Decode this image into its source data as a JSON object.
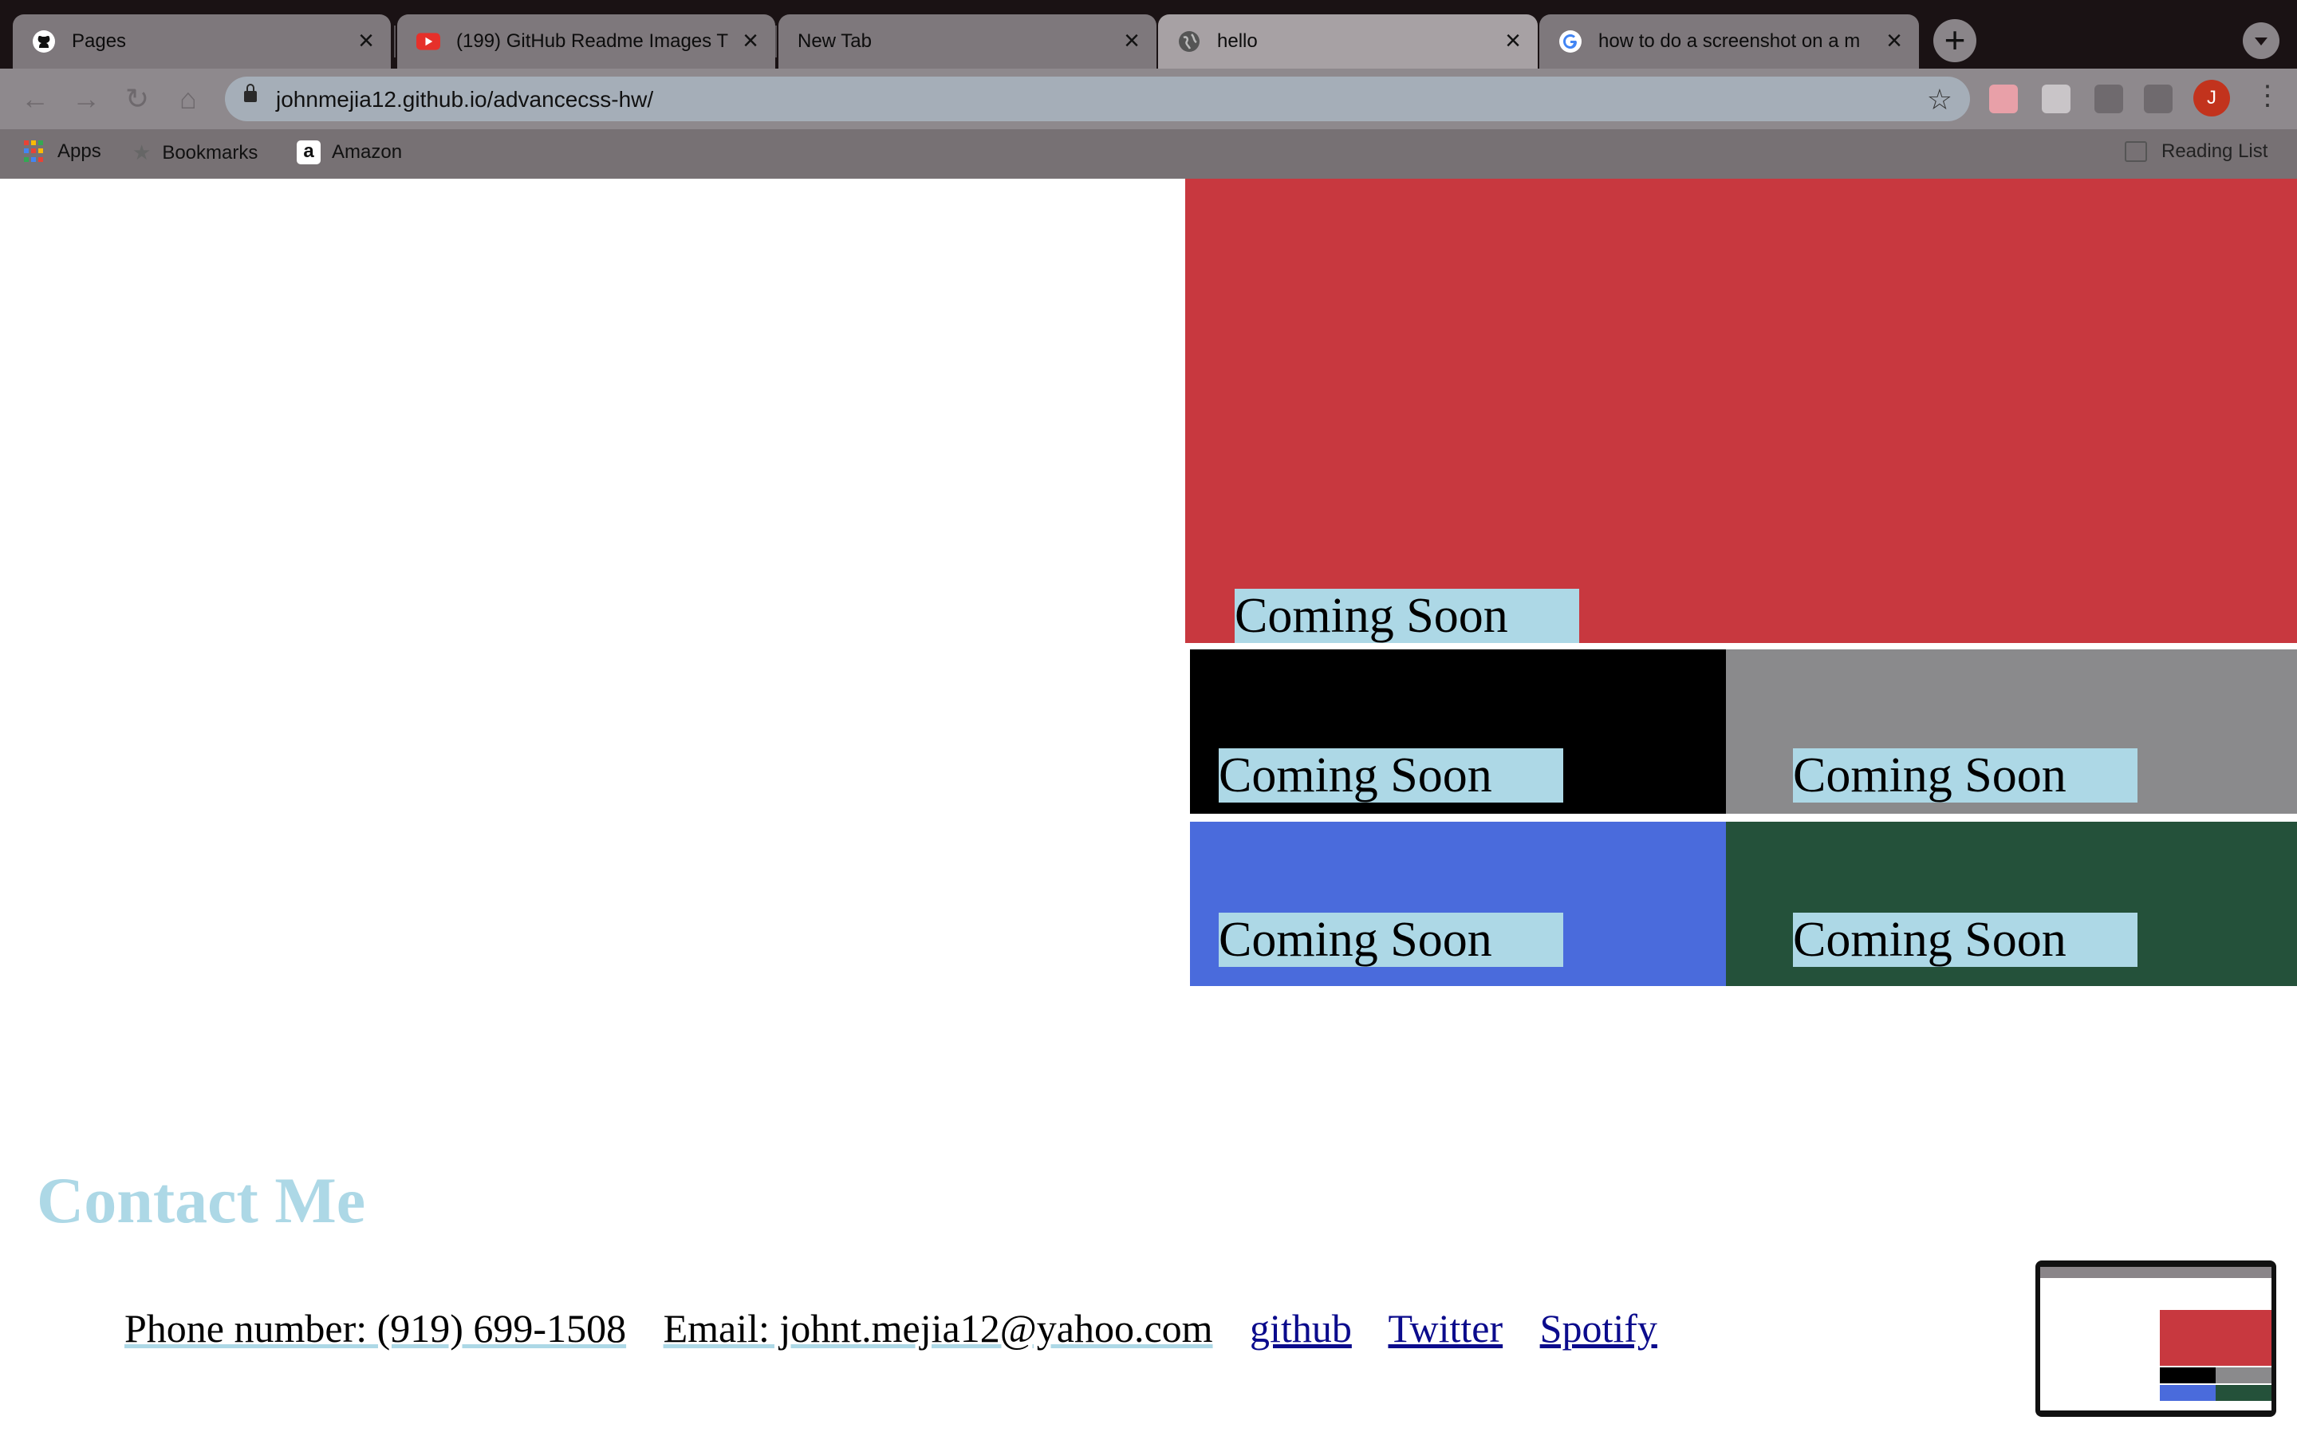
{
  "browser": {
    "tabs": [
      {
        "title": "Pages",
        "icon": "github-icon"
      },
      {
        "title": "(199) GitHub Readme Images T",
        "icon": "youtube-icon"
      },
      {
        "title": "New Tab",
        "icon": ""
      },
      {
        "title": "hello",
        "icon": "globe-icon",
        "active": true
      },
      {
        "title": "how to do a screenshot on a m",
        "icon": "google-icon"
      }
    ],
    "url": "johnmejia12.github.io/advancecss-hw/",
    "avatar_letter": "J",
    "bookmarks": [
      "Apps",
      "Bookmarks",
      "Amazon"
    ],
    "reading_list": "Reading List"
  },
  "portfolio": {
    "tiles": [
      {
        "label": "Coming Soon",
        "color": "#c8383f"
      },
      {
        "label": "Coming Soon",
        "color": "#000000"
      },
      {
        "label": "Coming Soon",
        "color": "#8a8a8c"
      },
      {
        "label": "Coming Soon",
        "color": "#4a6bdc"
      },
      {
        "label": "Coming Soon",
        "color": "#24513a"
      }
    ]
  },
  "contact": {
    "heading": "Contact Me",
    "phone": "Phone number: (919) 699-1508",
    "email": "Email: johnt.mejia12@yahoo.com",
    "links": [
      "github",
      "Twitter",
      "Spotify"
    ]
  },
  "colors": {
    "accent": "#add8e6"
  }
}
